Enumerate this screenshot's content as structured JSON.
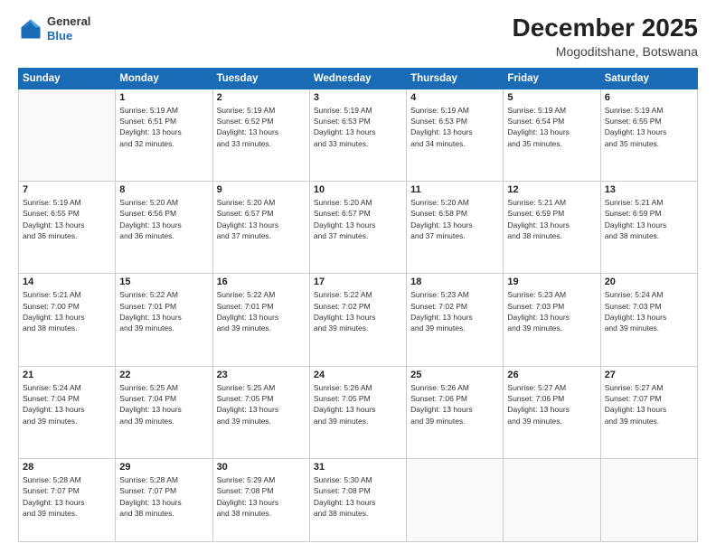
{
  "header": {
    "logo": {
      "general": "General",
      "blue": "Blue"
    },
    "title": "December 2025",
    "location": "Mogoditshane, Botswana"
  },
  "weekdays": [
    "Sunday",
    "Monday",
    "Tuesday",
    "Wednesday",
    "Thursday",
    "Friday",
    "Saturday"
  ],
  "weeks": [
    [
      {
        "day": "",
        "info": ""
      },
      {
        "day": "1",
        "info": "Sunrise: 5:19 AM\nSunset: 6:51 PM\nDaylight: 13 hours\nand 32 minutes."
      },
      {
        "day": "2",
        "info": "Sunrise: 5:19 AM\nSunset: 6:52 PM\nDaylight: 13 hours\nand 33 minutes."
      },
      {
        "day": "3",
        "info": "Sunrise: 5:19 AM\nSunset: 6:53 PM\nDaylight: 13 hours\nand 33 minutes."
      },
      {
        "day": "4",
        "info": "Sunrise: 5:19 AM\nSunset: 6:53 PM\nDaylight: 13 hours\nand 34 minutes."
      },
      {
        "day": "5",
        "info": "Sunrise: 5:19 AM\nSunset: 6:54 PM\nDaylight: 13 hours\nand 35 minutes."
      },
      {
        "day": "6",
        "info": "Sunrise: 5:19 AM\nSunset: 6:55 PM\nDaylight: 13 hours\nand 35 minutes."
      }
    ],
    [
      {
        "day": "7",
        "info": "Sunrise: 5:19 AM\nSunset: 6:55 PM\nDaylight: 13 hours\nand 36 minutes."
      },
      {
        "day": "8",
        "info": "Sunrise: 5:20 AM\nSunset: 6:56 PM\nDaylight: 13 hours\nand 36 minutes."
      },
      {
        "day": "9",
        "info": "Sunrise: 5:20 AM\nSunset: 6:57 PM\nDaylight: 13 hours\nand 37 minutes."
      },
      {
        "day": "10",
        "info": "Sunrise: 5:20 AM\nSunset: 6:57 PM\nDaylight: 13 hours\nand 37 minutes."
      },
      {
        "day": "11",
        "info": "Sunrise: 5:20 AM\nSunset: 6:58 PM\nDaylight: 13 hours\nand 37 minutes."
      },
      {
        "day": "12",
        "info": "Sunrise: 5:21 AM\nSunset: 6:59 PM\nDaylight: 13 hours\nand 38 minutes."
      },
      {
        "day": "13",
        "info": "Sunrise: 5:21 AM\nSunset: 6:59 PM\nDaylight: 13 hours\nand 38 minutes."
      }
    ],
    [
      {
        "day": "14",
        "info": "Sunrise: 5:21 AM\nSunset: 7:00 PM\nDaylight: 13 hours\nand 38 minutes."
      },
      {
        "day": "15",
        "info": "Sunrise: 5:22 AM\nSunset: 7:01 PM\nDaylight: 13 hours\nand 39 minutes."
      },
      {
        "day": "16",
        "info": "Sunrise: 5:22 AM\nSunset: 7:01 PM\nDaylight: 13 hours\nand 39 minutes."
      },
      {
        "day": "17",
        "info": "Sunrise: 5:22 AM\nSunset: 7:02 PM\nDaylight: 13 hours\nand 39 minutes."
      },
      {
        "day": "18",
        "info": "Sunrise: 5:23 AM\nSunset: 7:02 PM\nDaylight: 13 hours\nand 39 minutes."
      },
      {
        "day": "19",
        "info": "Sunrise: 5:23 AM\nSunset: 7:03 PM\nDaylight: 13 hours\nand 39 minutes."
      },
      {
        "day": "20",
        "info": "Sunrise: 5:24 AM\nSunset: 7:03 PM\nDaylight: 13 hours\nand 39 minutes."
      }
    ],
    [
      {
        "day": "21",
        "info": "Sunrise: 5:24 AM\nSunset: 7:04 PM\nDaylight: 13 hours\nand 39 minutes."
      },
      {
        "day": "22",
        "info": "Sunrise: 5:25 AM\nSunset: 7:04 PM\nDaylight: 13 hours\nand 39 minutes."
      },
      {
        "day": "23",
        "info": "Sunrise: 5:25 AM\nSunset: 7:05 PM\nDaylight: 13 hours\nand 39 minutes."
      },
      {
        "day": "24",
        "info": "Sunrise: 5:26 AM\nSunset: 7:05 PM\nDaylight: 13 hours\nand 39 minutes."
      },
      {
        "day": "25",
        "info": "Sunrise: 5:26 AM\nSunset: 7:06 PM\nDaylight: 13 hours\nand 39 minutes."
      },
      {
        "day": "26",
        "info": "Sunrise: 5:27 AM\nSunset: 7:06 PM\nDaylight: 13 hours\nand 39 minutes."
      },
      {
        "day": "27",
        "info": "Sunrise: 5:27 AM\nSunset: 7:07 PM\nDaylight: 13 hours\nand 39 minutes."
      }
    ],
    [
      {
        "day": "28",
        "info": "Sunrise: 5:28 AM\nSunset: 7:07 PM\nDaylight: 13 hours\nand 39 minutes."
      },
      {
        "day": "29",
        "info": "Sunrise: 5:28 AM\nSunset: 7:07 PM\nDaylight: 13 hours\nand 38 minutes."
      },
      {
        "day": "30",
        "info": "Sunrise: 5:29 AM\nSunset: 7:08 PM\nDaylight: 13 hours\nand 38 minutes."
      },
      {
        "day": "31",
        "info": "Sunrise: 5:30 AM\nSunset: 7:08 PM\nDaylight: 13 hours\nand 38 minutes."
      },
      {
        "day": "",
        "info": ""
      },
      {
        "day": "",
        "info": ""
      },
      {
        "day": "",
        "info": ""
      }
    ]
  ]
}
